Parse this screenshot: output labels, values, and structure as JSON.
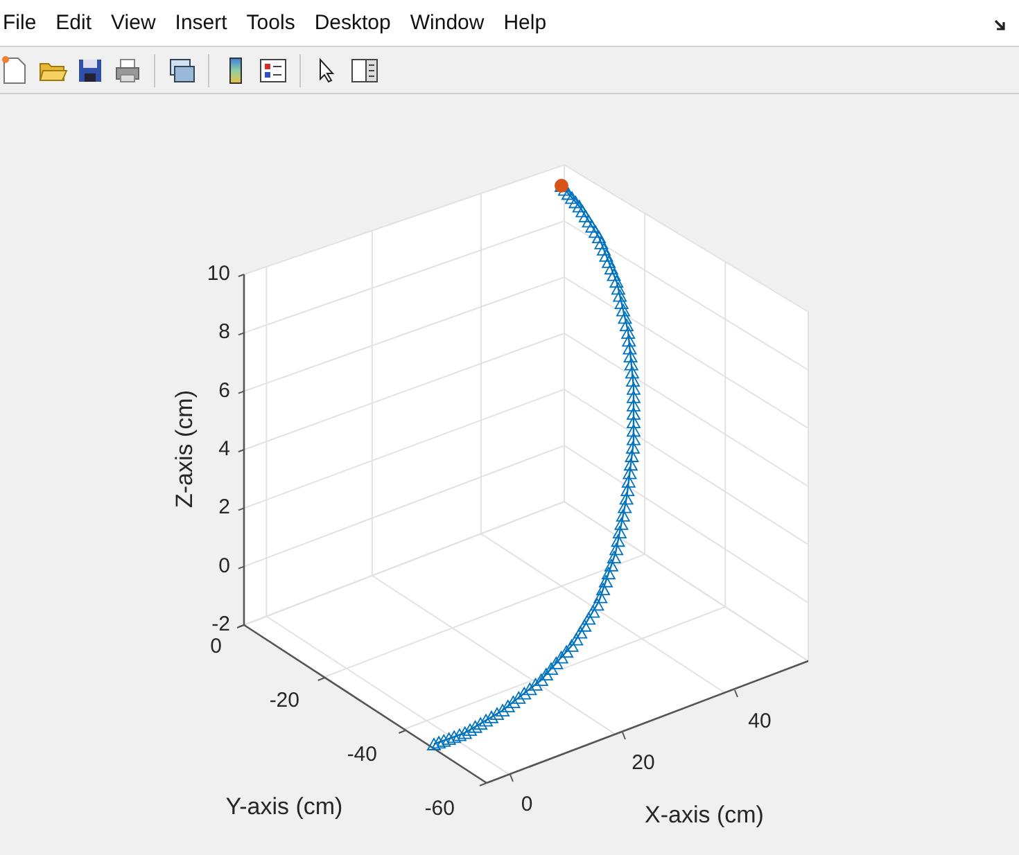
{
  "menu_bar": {
    "items": [
      "File",
      "Edit",
      "View",
      "Insert",
      "Tools",
      "Desktop",
      "Window",
      "Help"
    ]
  },
  "plot": {
    "z_label": "Z-axis (cm)",
    "y_label": "Y-axis (cm)",
    "x_label": "X-axis (cm)",
    "z_ticks": [
      "10",
      "8",
      "6",
      "4",
      "2",
      "0",
      "-2"
    ],
    "y_ticks": [
      "0",
      "-20",
      "-40",
      "-60"
    ],
    "x_ticks": [
      "0",
      "20",
      "40"
    ]
  }
}
